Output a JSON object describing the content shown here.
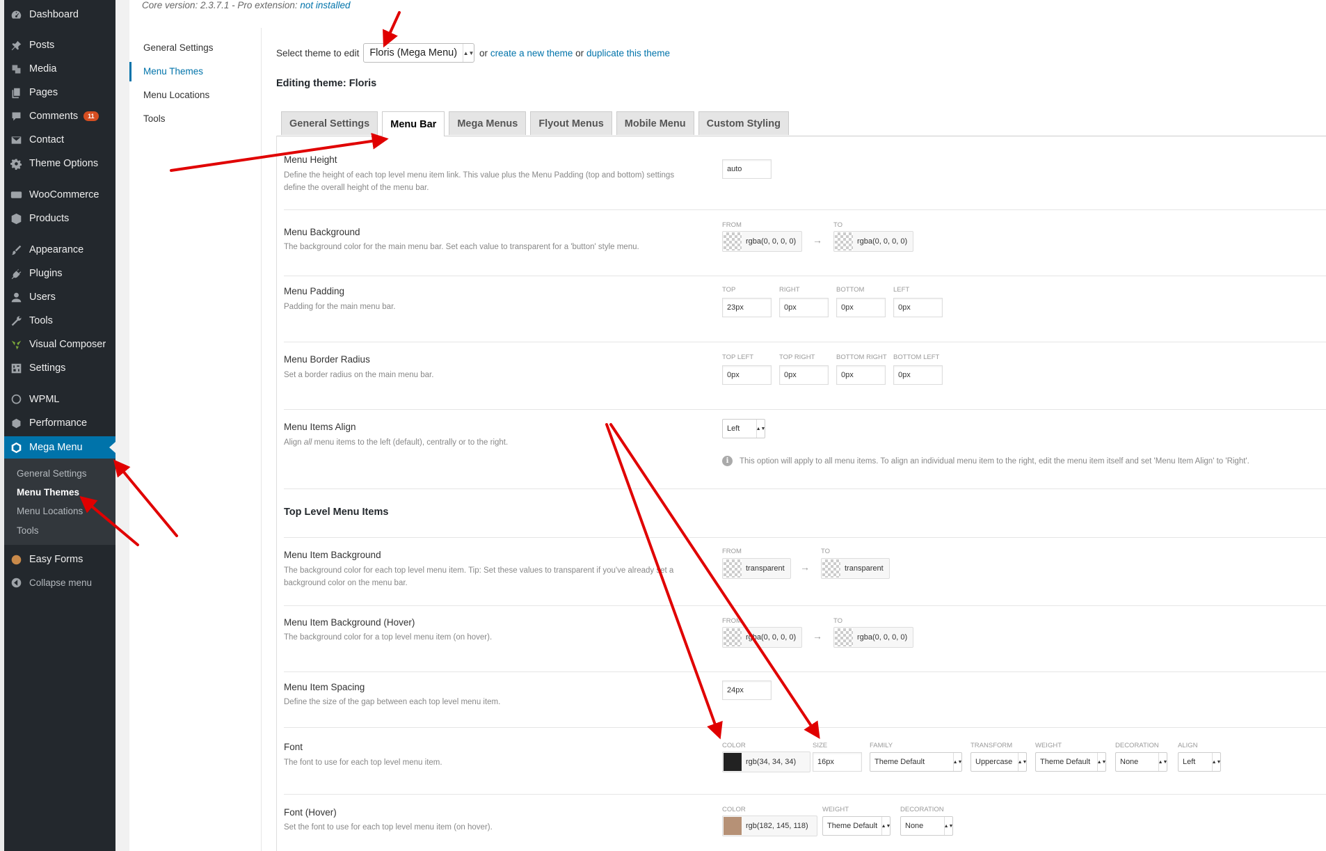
{
  "admin_menu": {
    "items": [
      {
        "label": "Dashboard",
        "icon": "dashboard-icon"
      },
      {
        "label": "Posts",
        "icon": "pin-icon"
      },
      {
        "label": "Media",
        "icon": "media-icon"
      },
      {
        "label": "Pages",
        "icon": "pages-icon"
      },
      {
        "label": "Comments",
        "icon": "comment-icon",
        "badge": "11"
      },
      {
        "label": "Contact",
        "icon": "mail-icon"
      },
      {
        "label": "Theme Options",
        "icon": "gear-icon"
      },
      {
        "label": "WooCommerce",
        "icon": "woo-icon"
      },
      {
        "label": "Products",
        "icon": "box-icon"
      },
      {
        "label": "Appearance",
        "icon": "brush-icon"
      },
      {
        "label": "Plugins",
        "icon": "plug-icon"
      },
      {
        "label": "Users",
        "icon": "user-icon"
      },
      {
        "label": "Tools",
        "icon": "wrench-icon"
      },
      {
        "label": "Visual Composer",
        "icon": "vc-icon"
      },
      {
        "label": "Settings",
        "icon": "settings-icon"
      },
      {
        "label": "WPML",
        "icon": "wpml-icon"
      },
      {
        "label": "Performance",
        "icon": "performance-icon"
      },
      {
        "label": "Mega Menu",
        "icon": "megamenu-icon"
      },
      {
        "label": "Easy Forms",
        "icon": "forms-icon"
      },
      {
        "label": "Collapse menu",
        "icon": "collapse-icon"
      }
    ],
    "submenu": [
      "General Settings",
      "Menu Themes",
      "Menu Locations",
      "Tools"
    ]
  },
  "core_version": {
    "prefix": "Core version: ",
    "version": "2.3.7.1",
    "middle": " - Pro extension: ",
    "link": "not installed"
  },
  "section_nav": [
    "General Settings",
    "Menu Themes",
    "Menu Locations",
    "Tools"
  ],
  "theme_select": {
    "label": "Select theme to edit",
    "value": "Floris (Mega Menu)",
    "or1": "or",
    "create_link": "create a new theme",
    "or2": "or",
    "duplicate_link": "duplicate this theme"
  },
  "editing_title": "Editing theme: Floris",
  "tabs": [
    "General Settings",
    "Menu Bar",
    "Mega Menus",
    "Flyout Menus",
    "Mobile Menu",
    "Custom Styling"
  ],
  "rows": {
    "menu_height": {
      "title": "Menu Height",
      "desc": "Define the height of each top level menu item link. This value plus the Menu Padding (top and bottom) settings define the overall height of the menu bar.",
      "value": "auto"
    },
    "menu_background": {
      "title": "Menu Background",
      "desc": "The background color for the main menu bar. Set each value to transparent for a 'button' style menu.",
      "from_label": "FROM",
      "from": "rgba(0, 0, 0, 0)",
      "to_label": "TO",
      "to": "rgba(0, 0, 0, 0)"
    },
    "menu_padding": {
      "title": "Menu Padding",
      "desc": "Padding for the main menu bar.",
      "labels": [
        "TOP",
        "RIGHT",
        "BOTTOM",
        "LEFT"
      ],
      "values": [
        "23px",
        "0px",
        "0px",
        "0px"
      ]
    },
    "menu_border_radius": {
      "title": "Menu Border Radius",
      "desc": "Set a border radius on the main menu bar.",
      "labels": [
        "TOP LEFT",
        "TOP RIGHT",
        "BOTTOM RIGHT",
        "BOTTOM LEFT"
      ],
      "values": [
        "0px",
        "0px",
        "0px",
        "0px"
      ]
    },
    "menu_items_align": {
      "title": "Menu Items Align",
      "desc_pre": "Align ",
      "desc_em": "all",
      "desc_post": " menu items to the left (default), centrally or to the right.",
      "value": "Left",
      "info": "This option will apply to all menu items. To align an individual menu item to the right, edit the menu item itself and set 'Menu Item Align' to 'Right'."
    },
    "section_title": "Top Level Menu Items",
    "item_background": {
      "title": "Menu Item Background",
      "desc": "The background color for each top level menu item. Tip: Set these values to transparent if you've already set a background color on the menu bar.",
      "from_label": "FROM",
      "from": "transparent",
      "to_label": "TO",
      "to": "transparent"
    },
    "item_background_hover": {
      "title": "Menu Item Background (Hover)",
      "desc": "The background color for a top level menu item (on hover).",
      "from_label": "FROM",
      "from": "rgba(0, 0, 0, 0)",
      "to_label": "TO",
      "to": "rgba(0, 0, 0, 0)"
    },
    "item_spacing": {
      "title": "Menu Item Spacing",
      "desc": "Define the size of the gap between each top level menu item.",
      "value": "24px"
    },
    "font": {
      "title": "Font",
      "desc": "The font to use for each top level menu item.",
      "color_label": "COLOR",
      "color": "rgb(34, 34, 34)",
      "color_hex": "#222222",
      "size_label": "SIZE",
      "size": "16px",
      "family_label": "FAMILY",
      "family": "Theme Default",
      "transform_label": "TRANSFORM",
      "transform": "Uppercase",
      "weight_label": "WEIGHT",
      "weight": "Theme Default",
      "decoration_label": "DECORATION",
      "decoration": "None",
      "align_label": "ALIGN",
      "align": "Left"
    },
    "font_hover": {
      "title": "Font (Hover)",
      "desc": "Set the font to use for each top level menu item (on hover).",
      "color_label": "COLOR",
      "color": "rgb(182, 145, 118)",
      "color_hex": "#b69176",
      "weight_label": "WEIGHT",
      "weight": "Theme Default",
      "decoration_label": "DECORATION",
      "decoration": "None"
    }
  },
  "colors": {
    "sidebar": "#23282d",
    "accent": "#0073aa",
    "annotation": "#e00000"
  }
}
